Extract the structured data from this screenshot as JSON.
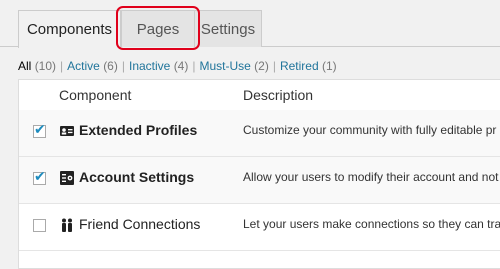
{
  "tabs": [
    {
      "label": "Components",
      "active": true
    },
    {
      "label": "Pages",
      "active": false
    },
    {
      "label": "Settings",
      "active": false
    }
  ],
  "filters": [
    {
      "label": "All",
      "count": "(10)",
      "current": true
    },
    {
      "label": "Active",
      "count": "(6)",
      "current": false
    },
    {
      "label": "Inactive",
      "count": "(4)",
      "current": false
    },
    {
      "label": "Must-Use",
      "count": "(2)",
      "current": false
    },
    {
      "label": "Retired",
      "count": "(1)",
      "current": false
    }
  ],
  "filter_separator": "|",
  "table": {
    "columns": [
      "Component",
      "Description"
    ],
    "rows": [
      {
        "checked": true,
        "name": "Extended Profiles",
        "description": "Customize your community with fully editable pr",
        "icon": "id-card-icon"
      },
      {
        "checked": true,
        "name": "Account Settings",
        "description": "Allow your users to modify their account and not",
        "icon": "account-settings-icon"
      },
      {
        "checked": false,
        "name": "Friend Connections",
        "description": "Let your users make connections so they can trac",
        "icon": "friends-icon"
      }
    ]
  },
  "colors": {
    "link": "#21759b",
    "highlight": "#e0001b",
    "check": "#1e8cbe"
  }
}
